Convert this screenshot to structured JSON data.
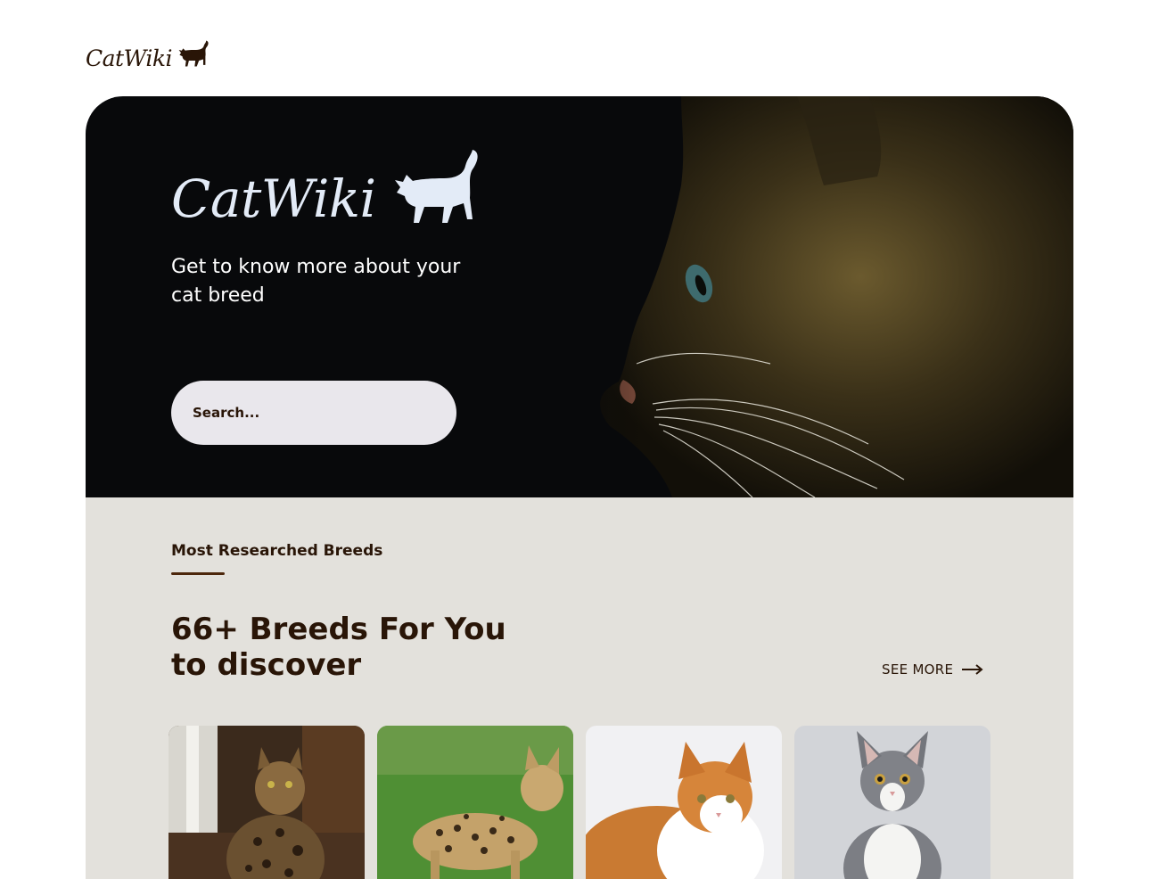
{
  "header": {
    "logo_text": "CatWiki"
  },
  "hero": {
    "logo_text": "CatWiki",
    "tagline": "Get to know more about your cat breed",
    "search_placeholder": "Search..."
  },
  "breeds_section": {
    "label": "Most Researched Breeds",
    "heading": "66+ Breeds For You to discover",
    "see_more": "SEE MORE"
  },
  "colors": {
    "brand_dark": "#291507",
    "hero_bg": "#08090b",
    "section_bg": "#e3e1dc",
    "search_bg": "#e9e7ec",
    "accent_underline": "#4d270c"
  }
}
